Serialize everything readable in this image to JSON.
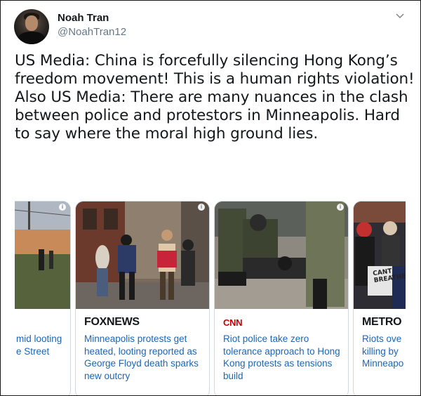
{
  "author": {
    "display_name": "Noah Tran",
    "handle": "@NoahTran12"
  },
  "tweet_text": "US Media: China is forcefully silencing Hong Kong’s freedom movement! This is a human rights violation!\nAlso US Media: There are many nuances in the clash between police and protestors in Minneapolis. Hard to say where the moral high ground lies.",
  "cards": [
    {
      "source": "",
      "headline": "mid looting\ne Street"
    },
    {
      "source": "FOXNEWS",
      "headline": "Minneapolis protests get heated, looting reported as George Floyd death sparks new outcry"
    },
    {
      "source": "CNN",
      "headline": "Riot police take zero tolerance approach to Hong Kong protests as tensions build"
    },
    {
      "source": "METRO",
      "headline": "Riots ove\nkilling by\nMinneapo"
    }
  ],
  "sign_text": "CANT\nBREATHE",
  "colors": {
    "link": "#1b66b8",
    "handle": "#657786",
    "border": "#cfd9de",
    "cnn_red": "#cc0000"
  },
  "icons": {
    "menu": "chevron-down-icon",
    "card_badge": "info-icon"
  }
}
